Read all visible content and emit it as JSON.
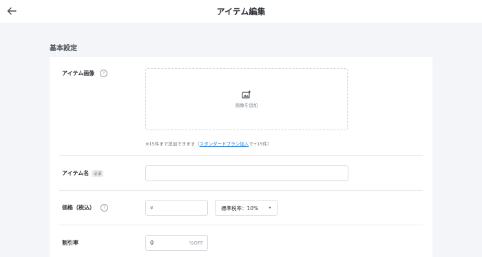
{
  "header": {
    "title": "アイテム編集",
    "back_icon": "arrow-left-icon"
  },
  "section": {
    "title": "基本設定"
  },
  "fields": {
    "image": {
      "label": "アイテム画像",
      "help": "?",
      "upload_text": "画像を追加",
      "note_prefix": "※15件まで追加できます（",
      "note_link": "スタンダードプラン加入",
      "note_suffix": "で+15件）"
    },
    "name": {
      "label": "アイテム名",
      "required_badge": "必須",
      "value": ""
    },
    "price": {
      "label": "価格（税込）",
      "help": "?",
      "currency_prefix": "¥",
      "value": "",
      "tax_select": "標準税率：10%"
    },
    "discount": {
      "label": "割引率",
      "value": "0",
      "suffix": "%OFF"
    }
  },
  "colors": {
    "background": "#f3f5f8",
    "card": "#ffffff",
    "link": "#2a7fd6",
    "border": "#d5d9de"
  }
}
